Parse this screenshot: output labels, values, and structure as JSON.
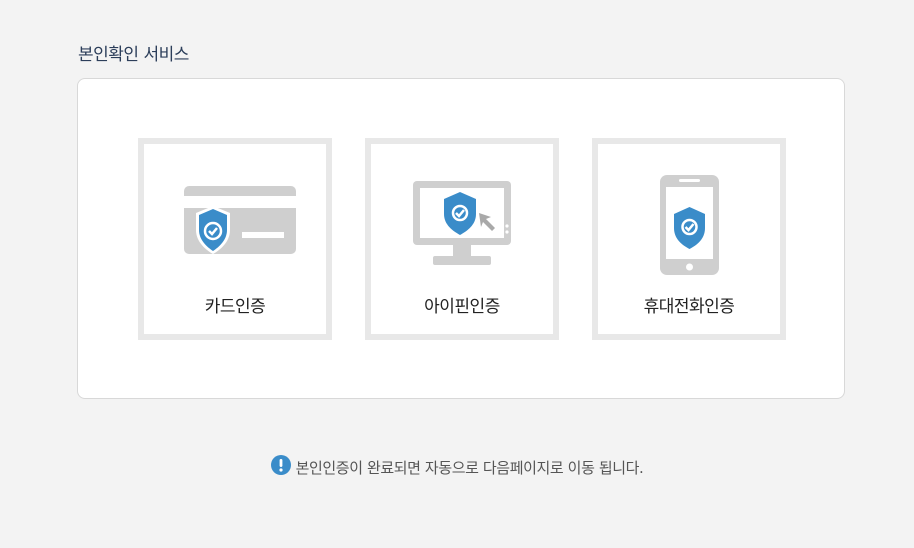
{
  "section": {
    "title": "본인확인 서비스"
  },
  "options": [
    {
      "label": "카드인증",
      "icon": "card-shield-icon"
    },
    {
      "label": "아이핀인증",
      "icon": "monitor-shield-icon"
    },
    {
      "label": "휴대전화인증",
      "icon": "phone-shield-icon"
    }
  ],
  "notice": {
    "text": "본인인증이 완료되면 자동으로 다음페이지로 이동 됩니다.",
    "icon": "exclamation-icon"
  },
  "colors": {
    "accent": "#3a8cc9",
    "icon_gray": "#cfcfcf",
    "title": "#2c3e5a",
    "box_border": "#e8e8e8"
  }
}
